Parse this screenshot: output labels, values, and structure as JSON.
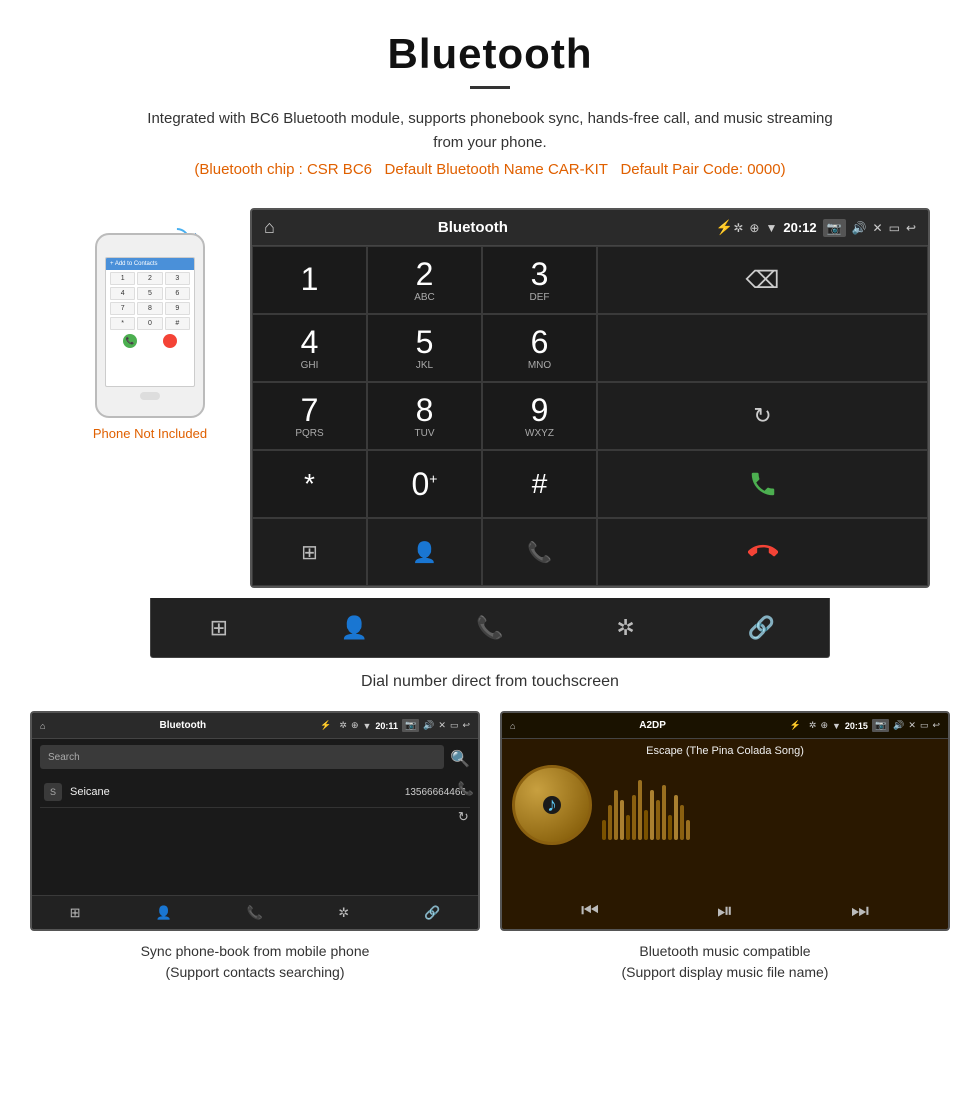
{
  "header": {
    "title": "Bluetooth",
    "description": "Integrated with BC6 Bluetooth module, supports phonebook sync, hands-free call, and music streaming from your phone.",
    "specs": "(Bluetooth chip : CSR BC6    Default Bluetooth Name CAR-KIT    Default Pair Code: 0000)",
    "spec1": "(Bluetooth chip : CSR BC6",
    "spec2": "Default Bluetooth Name CAR-KIT",
    "spec3": "Default Pair Code: 0000)"
  },
  "phone_label": "Phone Not Included",
  "main_screen": {
    "status_bar": {
      "title": "Bluetooth",
      "time": "20:12"
    },
    "dialpad": {
      "keys": [
        {
          "num": "1",
          "letters": ""
        },
        {
          "num": "2",
          "letters": "ABC"
        },
        {
          "num": "3",
          "letters": "DEF"
        },
        {
          "num": "4",
          "letters": "GHI"
        },
        {
          "num": "5",
          "letters": "JKL"
        },
        {
          "num": "6",
          "letters": "MNO"
        },
        {
          "num": "7",
          "letters": "PQRS"
        },
        {
          "num": "8",
          "letters": "TUV"
        },
        {
          "num": "9",
          "letters": "WXYZ"
        },
        {
          "num": "*",
          "letters": ""
        },
        {
          "num": "0",
          "letters": "+"
        },
        {
          "num": "#",
          "letters": ""
        }
      ]
    },
    "caption": "Dial number direct from touchscreen"
  },
  "phonebook_screen": {
    "status_bar": {
      "title": "Bluetooth",
      "time": "20:11"
    },
    "search_placeholder": "Search",
    "contacts": [
      {
        "letter": "S",
        "name": "Seicane",
        "phone": "13566664466"
      }
    ]
  },
  "music_screen": {
    "status_bar": {
      "title": "A2DP",
      "time": "20:15"
    },
    "song_title": "Escape (The Pina Colada Song)"
  },
  "bottom_caption_left": "Sync phone-book from mobile phone\n(Support contacts searching)",
  "bottom_caption_left_line1": "Sync phone-book from mobile phone",
  "bottom_caption_left_line2": "(Support contacts searching)",
  "bottom_caption_right_line1": "Bluetooth music compatible",
  "bottom_caption_right_line2": "(Support display music file name)"
}
